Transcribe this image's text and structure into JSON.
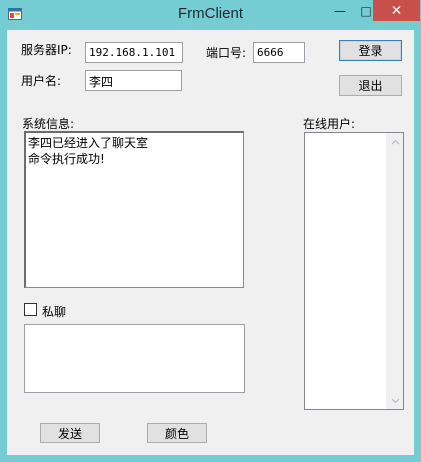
{
  "window": {
    "title": "FrmClient",
    "minimize_glyph": "—",
    "maximize_glyph": "□",
    "close_glyph": "✕"
  },
  "form": {
    "server_ip_label": "服务器IP:",
    "server_ip_value": "192.168.1.101",
    "port_label": "端口号:",
    "port_value": "6666",
    "username_label": "用户名:",
    "username_value": "李四",
    "login_label": "登录",
    "logout_label": "退出"
  },
  "system_info": {
    "label": "系统信息:",
    "lines": [
      "李四已经进入了聊天室",
      "命令执行成功!"
    ]
  },
  "online_users": {
    "label": "在线用户:",
    "items": []
  },
  "private_chat": {
    "label": "私聊",
    "checked": false
  },
  "message": {
    "value": ""
  },
  "actions": {
    "send_label": "发送",
    "color_label": "颜色"
  },
  "colors": {
    "title_bar": "#74cdd2",
    "close_button": "#c7504b",
    "client_bg": "#f0f0f0"
  }
}
